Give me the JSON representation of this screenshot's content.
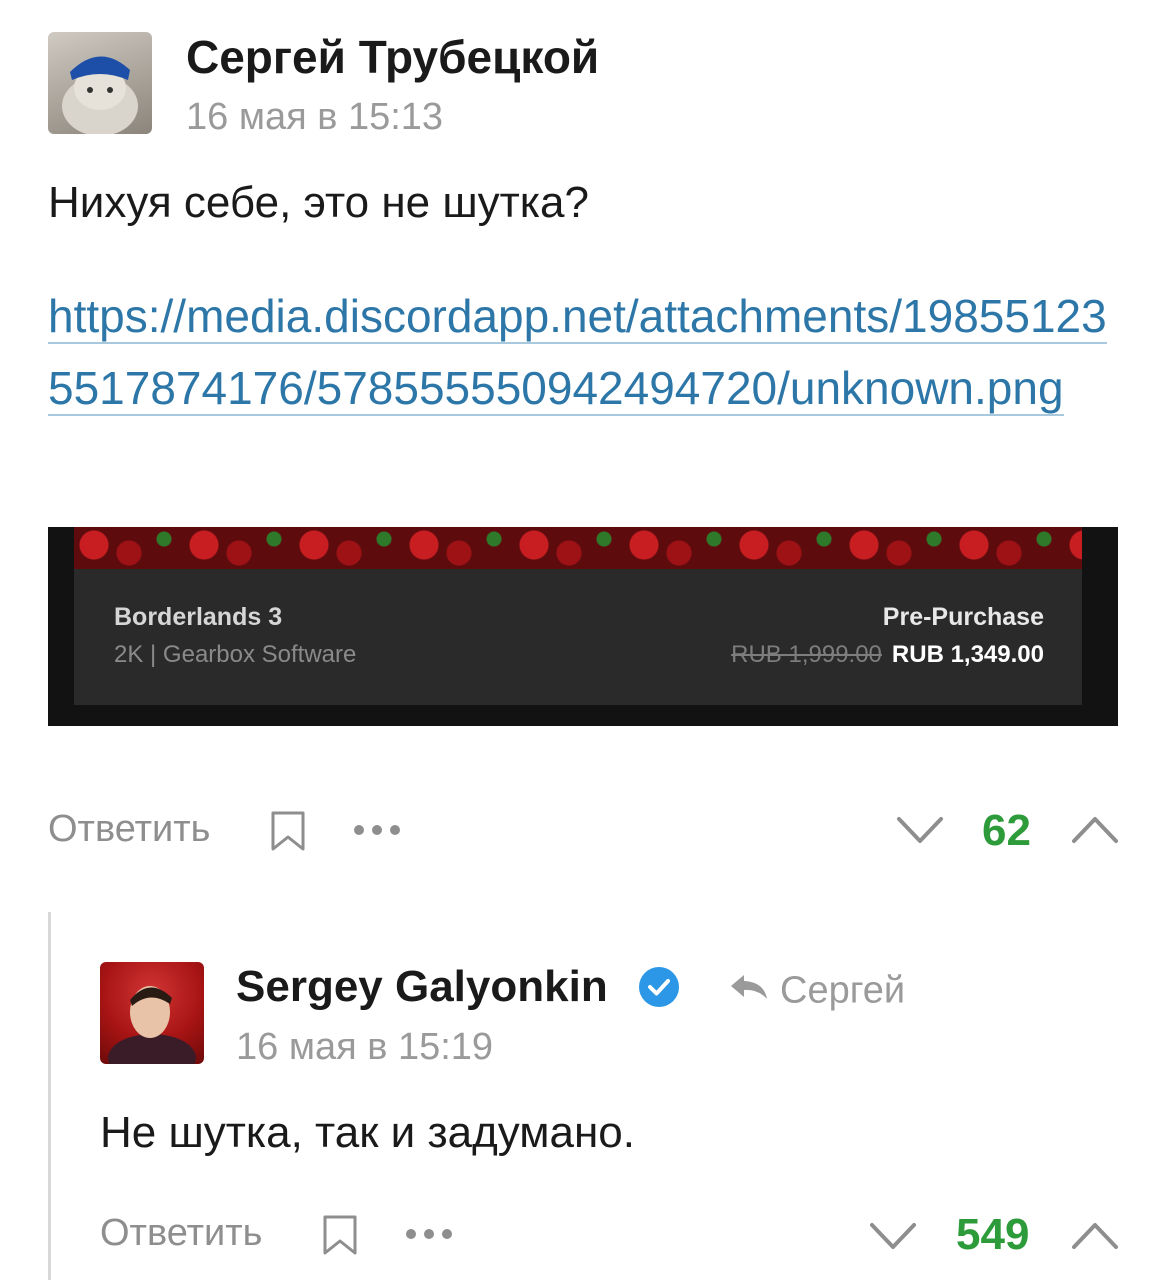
{
  "comment": {
    "author": "Сергей Трубецкой",
    "time": "16 мая в 15:13",
    "text": "Нихуя себе, это не шутка?",
    "link": "https://media.discordapp.net/attachments/198551235517874176/578555550942494720/unknown.png",
    "embed": {
      "game_title": "Borderlands 3",
      "publisher": "2K | Gearbox Software",
      "badge": "Pre-Purchase",
      "old_price": "RUB 1,999.00",
      "new_price": "RUB 1,349.00"
    },
    "actions": {
      "reply": "Ответить",
      "score": "62"
    }
  },
  "reply": {
    "author": "Sergey Galyonkin",
    "verified": true,
    "reply_to": "Сергей",
    "time": "16 мая в 15:19",
    "text": "Не шутка, так и задумано.",
    "actions": {
      "reply": "Ответить",
      "score": "549"
    }
  },
  "icons": {
    "bookmark": "bookmark-icon",
    "more": "more-icon",
    "vote_down": "chevron-down-icon",
    "vote_up": "chevron-up-icon",
    "verified": "verified-check-icon",
    "reply_arrow": "reply-arrow-icon"
  },
  "colors": {
    "link": "#2c76a8",
    "score": "#2e9b3a",
    "verified": "#2b97e6",
    "muted": "#9a9a9a"
  }
}
